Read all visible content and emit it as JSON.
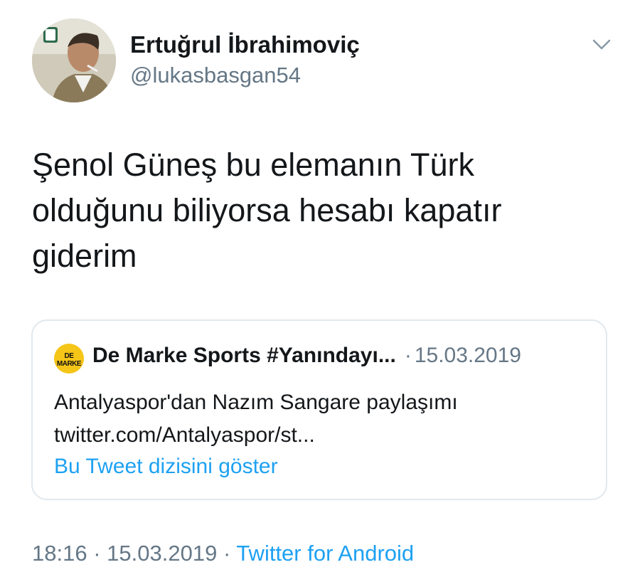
{
  "author": {
    "name": "Ertuğrul İbrahimoviç",
    "handle": "@lukasbasgan54"
  },
  "tweet": {
    "lines": [
      "Şenol Güneş bu elemanın Türk",
      "olduğunu biliyorsa hesabı kapatır",
      "giderim"
    ]
  },
  "quoted_tweet": {
    "avatar_text": "DE MARKE",
    "name": "De Marke Sports #Yanındayı...",
    "separator": "·",
    "date": "15.03.2019",
    "text_lines": [
      "Antalyaspor'dan Nazım Sangare paylaşımı",
      "twitter.com/Antalyaspor/st..."
    ],
    "thread_link": "Bu Tweet dizisini göster"
  },
  "meta": {
    "time": "18:16",
    "sep1": "·",
    "date": "15.03.2019",
    "sep2": "·",
    "source": "Twitter for Android"
  },
  "icons": {
    "menu": "chevron-down-icon"
  },
  "colors": {
    "text": "#14171a",
    "secondary": "#657786",
    "link": "#1da1f2",
    "border": "#e1e8ed",
    "quote_avatar_bg": "#f5c518"
  }
}
